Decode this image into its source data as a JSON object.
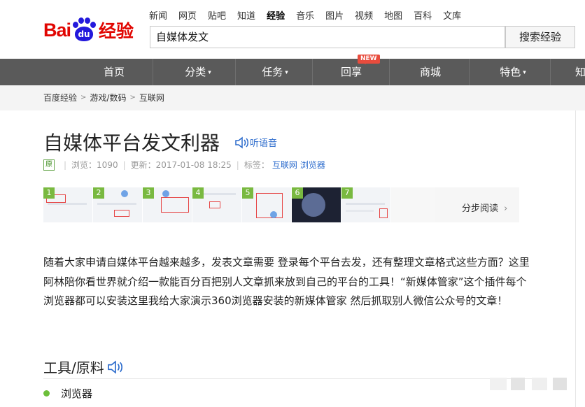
{
  "logo": {
    "bai": "Bai",
    "du": "du",
    "jingyan": "经验"
  },
  "top_nav": [
    "新闻",
    "网页",
    "贴吧",
    "知道",
    "经验",
    "音乐",
    "图片",
    "视频",
    "地图",
    "百科",
    "文库"
  ],
  "search": {
    "value": "自媒体发文",
    "button": "搜索经验"
  },
  "main_nav": {
    "items": [
      "首页",
      "分类",
      "任务",
      "回享",
      "商城",
      "特色",
      "知"
    ],
    "caret": "⌄",
    "new_badge": "NEW"
  },
  "breadcrumb": [
    "百度经验",
    "游戏/数码",
    "互联网"
  ],
  "article": {
    "title": "自媒体平台发文利器",
    "listen": "听语音",
    "original_badge": "原",
    "views": "浏览：1090",
    "updated": "更新：2017-01-08 18:25",
    "tags_label": "标签：",
    "tags": [
      "互联网",
      "浏览器"
    ],
    "steps": [
      "1",
      "2",
      "3",
      "4",
      "5",
      "6",
      "7"
    ],
    "step_read": "分步阅读",
    "intro": "随着大家申请自媒体平台越来越多，发表文章需要 登录每个平台去发，还有整理文章格式这些方面？这里阿林陪你看世界就介绍一款能百分百把别人文章抓来放到自己的平台的工具！“新媒体管家”这个插件每个浏览器都可以安装这里我给大家演示360浏览器安装的新媒体管家 然后抓取别人微信公众号的文章！",
    "tools_heading": "工具/原料",
    "tools": [
      "浏览器"
    ]
  },
  "colors": {
    "brand_red": "#e10602",
    "brand_blue": "#2319dc",
    "nav_bg": "#5a5a5a",
    "link_blue": "#2a6acc",
    "step_green": "#79b940"
  },
  "icons": [
    "speaker-icon",
    "chevron-right-icon",
    "caret-down-icon"
  ]
}
